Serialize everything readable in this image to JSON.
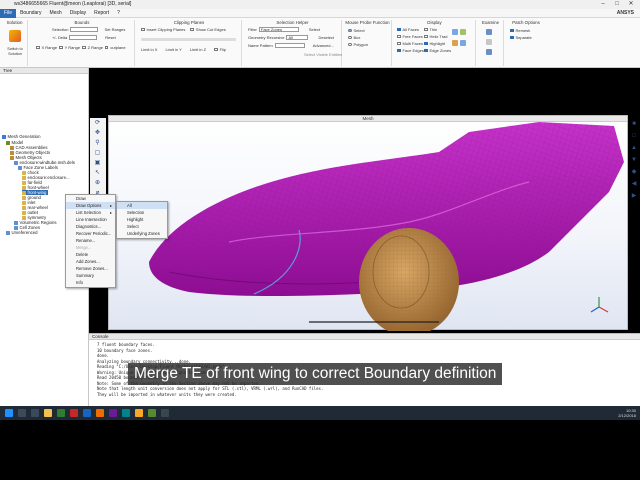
{
  "window": {
    "title": "ws3486655665 Fluent@meon (Leaplorai) [3D, serial]",
    "controls": [
      "–",
      "□",
      "✕"
    ]
  },
  "menu": {
    "items": [
      "File",
      "Boundary",
      "Mesh",
      "Display",
      "Report",
      "?"
    ],
    "active": "File",
    "brand": "ANSYS"
  },
  "ribbon": {
    "solution": {
      "title": "Solution",
      "button": "Switch to Solution"
    },
    "bounds": {
      "title": "Bounds",
      "selection_label": "Selection",
      "set_ranges": "Set Ranges",
      "delta_label": "+/- Delta",
      "reset": "Reset",
      "x_range": "X Range",
      "y_range": "Y Range",
      "z_range": "Z Range",
      "cutplane": "cutplane"
    },
    "clipping": {
      "title": "Clipping Planes",
      "insert": "Insert Clipping Planes",
      "show_cut_edges": "Show Cut Edges",
      "limit_x": "Limit in X",
      "limit_y": "Limit in Y",
      "limit_z": "Limit in Z",
      "flip": "Flip"
    },
    "selection_helper": {
      "title": "Selection Helper",
      "filter_label": "Filter",
      "filter_value": "Face Zones",
      "recursive_label": "Geometry Recursive",
      "recursive_value": "All",
      "name_pattern_label": "Name Pattern",
      "select": "Select",
      "deselect": "Deselect",
      "advanced": "Advanced...",
      "select_visible": "Select Visible Entities"
    },
    "mouse_probe": {
      "title": "Mouse Probe Function",
      "options": [
        "Select",
        "Box",
        "Polygon"
      ]
    },
    "display": {
      "title": "Display",
      "col1": [
        "All Faces",
        "Free Faces",
        "Multi Faces",
        "Face Edges"
      ],
      "col2": [
        "Thin",
        "Helix Trad",
        "Highlight",
        "Edge Zones"
      ]
    },
    "examine": {
      "title": "Examine"
    },
    "patch_options": {
      "title": "Patch Options",
      "remesh": "Remesh",
      "separate": "Separate"
    }
  },
  "tree": {
    "header": "Tree",
    "items": [
      {
        "label": "Mesh Generation",
        "color": "#3a7bd5"
      },
      {
        "label": "Model",
        "color": "#6b8e23"
      },
      {
        "label": "CAD Assemblies",
        "color": "#c08a2e"
      },
      {
        "label": "Geometry Objects",
        "color": "#c08a2e"
      },
      {
        "label": "Mesh Objects",
        "color": "#c08a2e"
      },
      {
        "label": "enclosure:windtube.msh.dels",
        "color": "#5f8fd1"
      },
      {
        "label": "Face Zone Labels",
        "color": "#5f8fd1"
      },
      {
        "label": "chock",
        "color": "#d9b44a"
      },
      {
        "label": "enclosure:enclosure...",
        "color": "#d9b44a"
      },
      {
        "label": "far-field",
        "color": "#d9b44a"
      },
      {
        "label": "front-wheel",
        "color": "#d9b44a"
      },
      {
        "label": "front-wing",
        "color": "#d9b44a"
      },
      {
        "label": "ground",
        "color": "#d9b44a"
      },
      {
        "label": "inlet",
        "color": "#d9b44a"
      },
      {
        "label": "rear-wheel",
        "color": "#d9b44a"
      },
      {
        "label": "outlet",
        "color": "#d9b44a"
      },
      {
        "label": "symmetry",
        "color": "#d9b44a"
      },
      {
        "label": "Volumetric Regions",
        "color": "#5f8fd1"
      },
      {
        "label": "Cell Zones",
        "color": "#5f8fd1"
      },
      {
        "label": "Unreferenced",
        "color": "#5f8fd1"
      }
    ]
  },
  "context_menu": {
    "items": [
      {
        "label": "Draw",
        "submenu": false,
        "disabled": false
      },
      {
        "label": "Draw Options",
        "submenu": true,
        "disabled": false
      },
      {
        "label": "List Selection",
        "submenu": true,
        "disabled": false
      },
      {
        "label": "Line Intersection",
        "submenu": false,
        "disabled": false
      },
      {
        "label": "Diagnostics...",
        "submenu": false,
        "disabled": false
      },
      {
        "label": "Recover Periodic...",
        "submenu": false,
        "disabled": false
      },
      {
        "label": "Rename...",
        "submenu": false,
        "disabled": false
      },
      {
        "label": "Merge...",
        "submenu": false,
        "disabled": true
      },
      {
        "label": "Delete",
        "submenu": false,
        "disabled": false
      },
      {
        "label": "Add Zones...",
        "submenu": false,
        "disabled": false
      },
      {
        "label": "Remove Zones...",
        "submenu": false,
        "disabled": false
      },
      {
        "label": "Summary",
        "submenu": false,
        "disabled": false
      },
      {
        "label": "Info",
        "submenu": false,
        "disabled": false
      }
    ],
    "submenu": [
      "All",
      "Selection",
      "Highlight",
      "Select",
      "Underlying Zones"
    ]
  },
  "viewport": {
    "title": "Mesh",
    "colors": {
      "body": "#b312b8",
      "wheel": "#c08d4e",
      "background": "#f3f5fb"
    }
  },
  "console": {
    "header": "Console",
    "lines": [
      "7 fluent boundary faces.",
      "10 boundary face zones.",
      "done.",
      "Analyzing boundary connectivity...done.",
      "Reading \"C:/Users/Desktop/Fluent_Meshing/CAD/W1.pmdb\" ...",
      "Warning: Unique names not found. Ignoring names.",
      "Read 20450 boundary faces.",
      "Note: Some of the Geometry in the Section above may not be imported.",
      "Note that length unit conversion does not apply for STL (.stl), VRML (.wrl), and RunCAD files.",
      "They will be imported in whatever units they were created."
    ]
  },
  "caption": {
    "text": "Merge TE of front wing to correct Boundary definition"
  },
  "taskbar": {
    "time": "10:30",
    "date": "2/12/2018"
  }
}
